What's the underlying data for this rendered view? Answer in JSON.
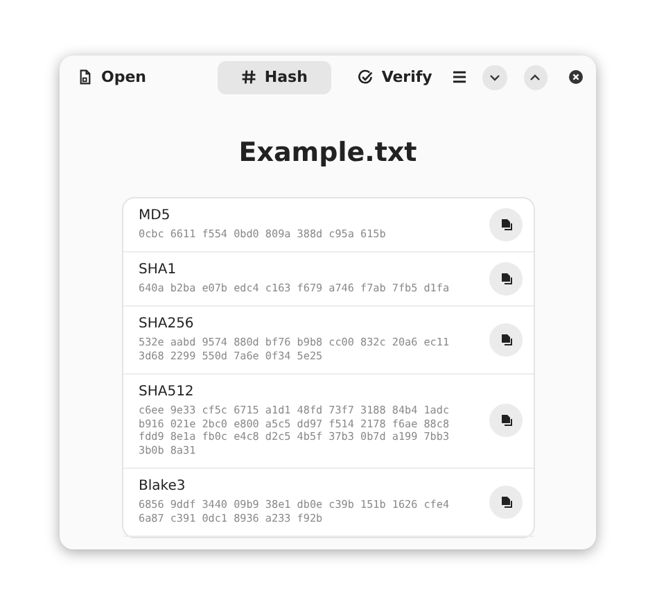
{
  "header": {
    "tabs": [
      {
        "label": "Open",
        "selected": false
      },
      {
        "label": "Hash",
        "selected": true
      },
      {
        "label": "Verify",
        "selected": false
      }
    ]
  },
  "title": "Example.txt",
  "hashes": [
    {
      "name": "MD5",
      "value": "0cbc 6611 f554 0bd0 809a 388d c95a 615b"
    },
    {
      "name": "SHA1",
      "value": "640a b2ba e07b edc4 c163 f679 a746 f7ab 7fb5 d1fa"
    },
    {
      "name": "SHA256",
      "value": "532e aabd 9574 880d bf76 b9b8 cc00 832c 20a6 ec11 3d68 2299 550d 7a6e 0f34 5e25"
    },
    {
      "name": "SHA512",
      "value": "c6ee 9e33 cf5c 6715 a1d1 48fd 73f7 3188 84b4 1adc b916 021e 2bc0 e800 a5c5 dd97 f514 2178 f6ae 88c8 fdd9 8e1a fb0c e4c8 d2c5 4b5f 37b3 0b7d a199 7bb3 3b0b 8a31"
    },
    {
      "name": "Blake3",
      "value": "6856 9ddf 3440 09b9 38e1 db0e c39b 151b 1626 cfe4 6a87 c391 0dc1 8936 a233 f92b"
    }
  ]
}
